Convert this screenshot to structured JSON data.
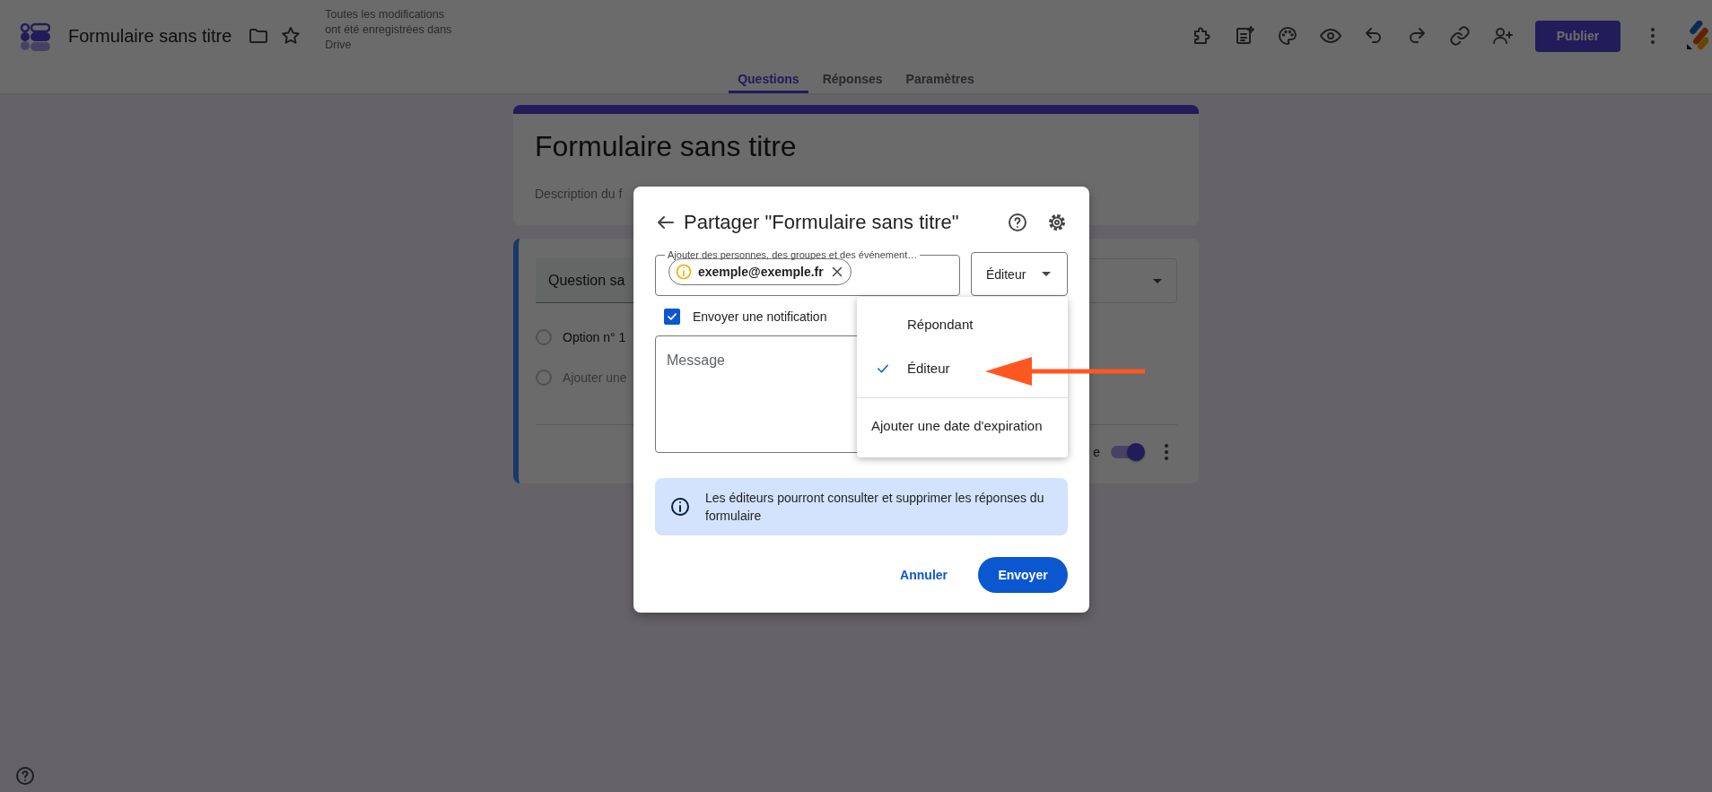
{
  "app_bar": {
    "title": "Formulaire sans titre",
    "save_status": "Toutes les modifications ont été enregistrées dans Drive",
    "publish_button": "Publier"
  },
  "tabs": [
    {
      "label": "Questions",
      "selected": true
    },
    {
      "label": "Réponses",
      "selected": false
    },
    {
      "label": "Paramètres",
      "selected": false
    }
  ],
  "form": {
    "title": "Formulaire sans titre",
    "description": "Description du f"
  },
  "question": {
    "title": "Question sa",
    "options": [
      {
        "label": "Option n° 1",
        "kind": "option",
        "selected": false
      },
      {
        "label": "Ajouter une",
        "kind": "add",
        "selected": false
      }
    ],
    "required_label": "e",
    "required": true
  },
  "share_dialog": {
    "title": "Partager \"Formulaire sans titre\"",
    "recipients_label": "Ajouter des personnes, des groupes et des événement…",
    "recipients": [
      {
        "email": "exemple@exemple.fr"
      }
    ],
    "role": "Éditeur",
    "notify": {
      "label": "Envoyer une notification",
      "checked": true
    },
    "message_placeholder": "Message",
    "info": "Les éditeurs pourront consulter et supprimer les réponses du formulaire",
    "cancel": "Annuler",
    "send": "Envoyer"
  },
  "role_menu": {
    "items": [
      {
        "label": "Répondant",
        "kind": "role",
        "selected": false
      },
      {
        "label": "Éditeur",
        "kind": "role",
        "selected": true
      },
      {
        "label": "Ajouter une date d'expiration",
        "kind": "action"
      }
    ]
  }
}
